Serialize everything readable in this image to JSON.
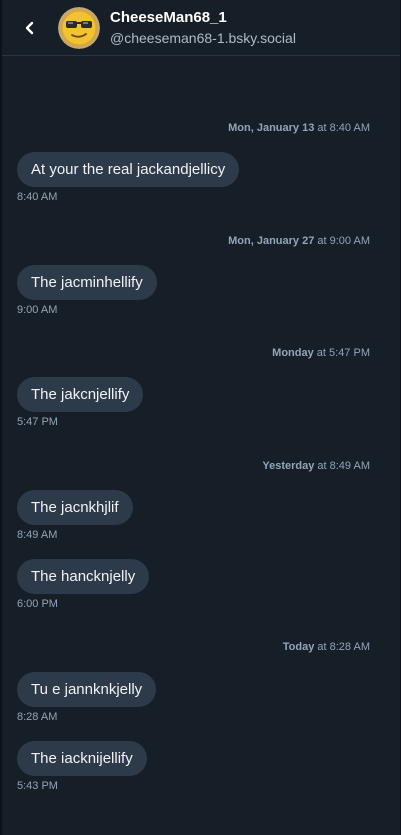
{
  "header": {
    "display_name": "CheeseMan68_1",
    "handle": "@cheeseman68-1.bsky.social"
  },
  "separators": [
    {
      "day": "Mon, January 13",
      "rest": " at 8:40 AM"
    },
    {
      "day": "Mon, January 27",
      "rest": " at 9:00 AM"
    },
    {
      "day": "Monday",
      "rest": " at 5:47 PM"
    },
    {
      "day": "Yesterday",
      "rest": " at 8:49 AM"
    },
    {
      "day": "Today",
      "rest": " at 8:28 AM"
    }
  ],
  "messages": [
    {
      "text": "At your the real jackandjellicy",
      "time": "8:40 AM"
    },
    {
      "text": "The jacminhellify",
      "time": "9:00 AM"
    },
    {
      "text": "The jakcnjellify",
      "time": "5:47 PM"
    },
    {
      "text": "The jacnkhjlif",
      "time": "8:49 AM"
    },
    {
      "text": "The hancknjelly",
      "time": "6:00 PM"
    },
    {
      "text": "Tu e jannknkjelly",
      "time": "8:28 AM"
    },
    {
      "text": "The iacknijellify",
      "time": "5:43 PM"
    }
  ],
  "icons": {
    "back": "chevron-left-icon",
    "avatar": "sunglasses-face-avatar"
  },
  "colors": {
    "background": "#161e27",
    "bubble": "#2d3a49",
    "muted_text": "#93a5b7"
  }
}
